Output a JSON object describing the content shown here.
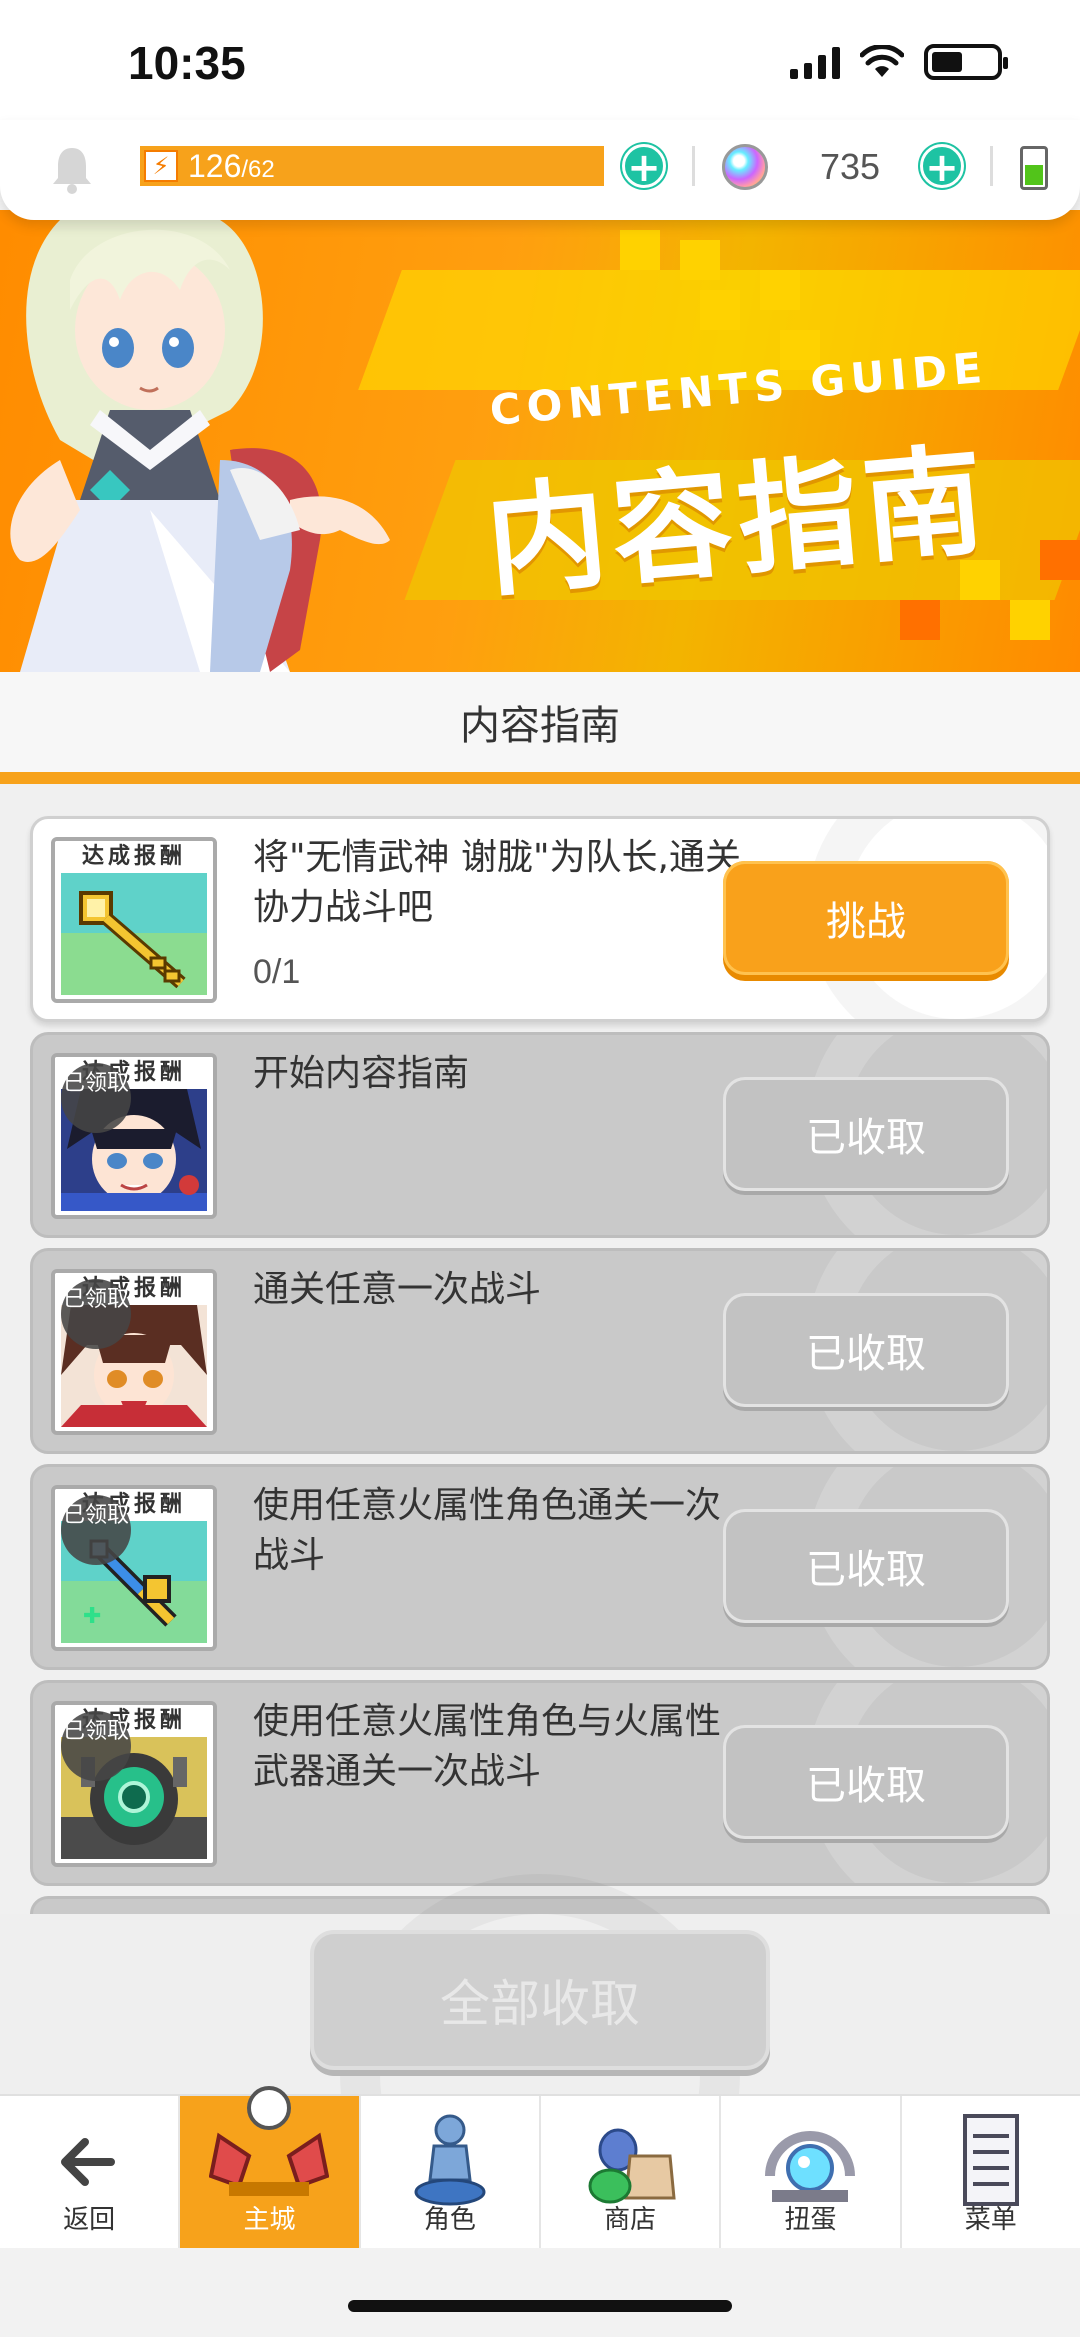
{
  "status_bar": {
    "time": "10:35"
  },
  "resources": {
    "stamina_current": "126",
    "stamina_max": "/62",
    "gems": "735"
  },
  "banner": {
    "title_en": "CONTENTS GUIDE",
    "title_cn": "内容指南"
  },
  "section_title": "内容指南",
  "quests": [
    {
      "reward_label": "达成报酬",
      "text": "将\"无情武神 谢胧\"为队长,通关协力战斗吧",
      "progress": "0/1",
      "button": "挑战",
      "claimed": false
    },
    {
      "reward_label": "达成报酬",
      "stamp": "已领取",
      "text": "开始内容指南",
      "button": "已收取",
      "claimed": true
    },
    {
      "reward_label": "达成报酬",
      "stamp": "已领取",
      "text": "通关任意一次战斗",
      "button": "已收取",
      "claimed": true
    },
    {
      "reward_label": "达成报酬",
      "stamp": "已领取",
      "text": "使用任意火属性角色通关一次战斗",
      "button": "已收取",
      "claimed": true
    },
    {
      "reward_label": "达成报酬",
      "stamp": "已领取",
      "text": "使用任意火属性角色与火属性武器通关一次战斗",
      "button": "已收取",
      "claimed": true
    }
  ],
  "claim_all": "全部收取",
  "nav": {
    "items": [
      {
        "label": "返回",
        "icon": "back-arrow-icon"
      },
      {
        "label": "主城",
        "icon": "castle-icon"
      },
      {
        "label": "角色",
        "icon": "character-icon"
      },
      {
        "label": "商店",
        "icon": "shop-icon"
      },
      {
        "label": "扭蛋",
        "icon": "gacha-icon"
      },
      {
        "label": "菜单",
        "icon": "menu-icon"
      }
    ]
  },
  "colors": {
    "accent": "#f7a21b",
    "plus": "#1ec3a3",
    "claimed": "#c2c2c2"
  }
}
